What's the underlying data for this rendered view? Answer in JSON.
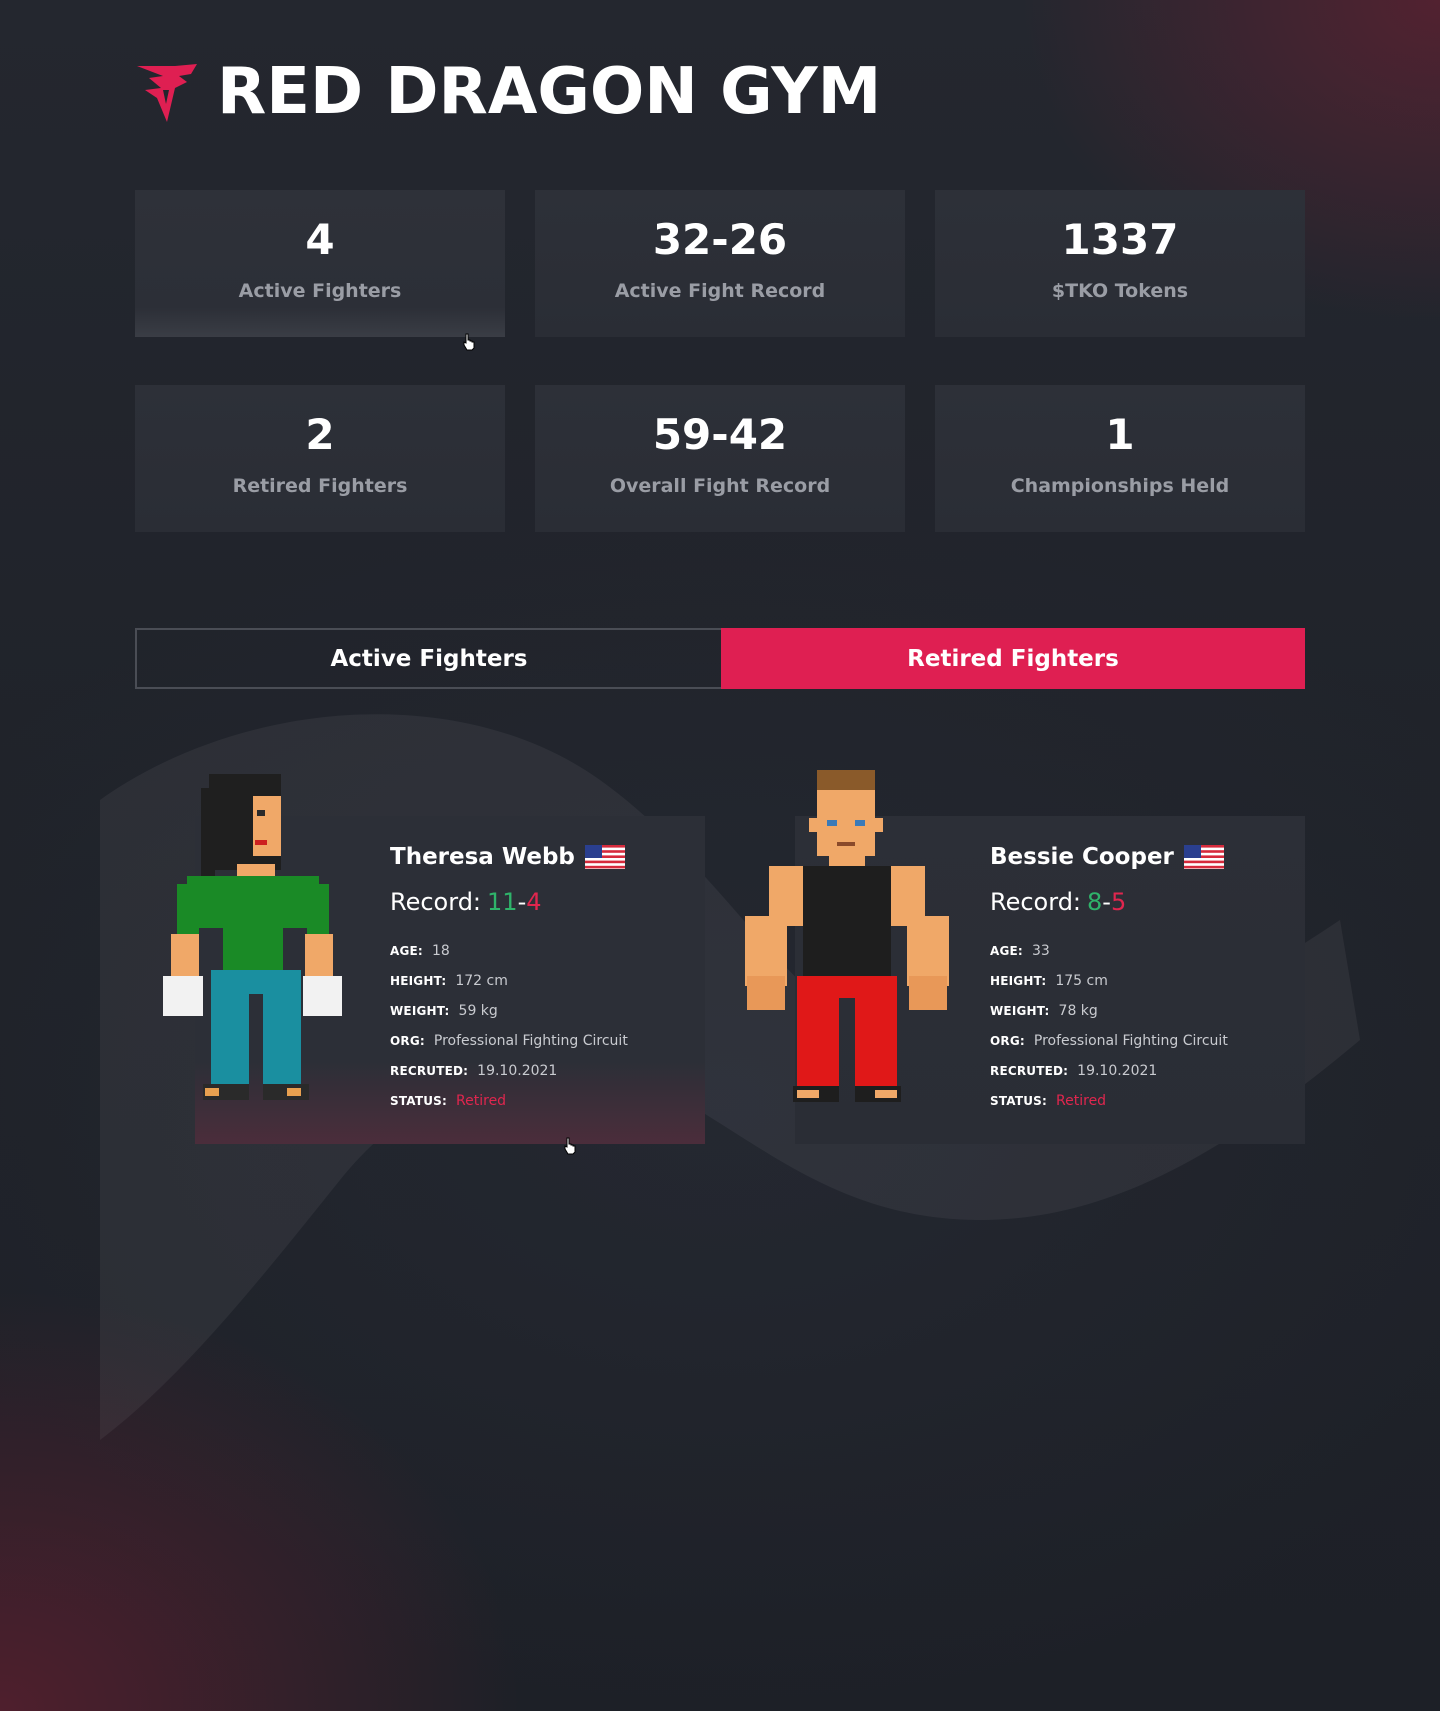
{
  "brand": {
    "title": "RED DRAGON GYM",
    "accent": "#df1f52"
  },
  "stats": [
    {
      "value": "4",
      "label": "Active Fighters"
    },
    {
      "value": "32-26",
      "label": "Active Fight Record"
    },
    {
      "value": "1337",
      "label": "$TKO Tokens"
    },
    {
      "value": "2",
      "label": "Retired Fighters"
    },
    {
      "value": "59-42",
      "label": "Overall Fight Record"
    },
    {
      "value": "1",
      "label": "Championships Held"
    }
  ],
  "tabs": {
    "active_label": "Active Fighters",
    "retired_label": "Retired Fighters",
    "selected": "Retired Fighters"
  },
  "fighters": [
    {
      "name": "Theresa Webb",
      "flag": "us-flag-icon",
      "record_label": "Record:",
      "wins": "11",
      "losses": "4",
      "age_key": "AGE:",
      "age": "18",
      "height_key": "HEIGHT:",
      "height": "172 cm",
      "weight_key": "WEIGHT:",
      "weight": "59 kg",
      "org_key": "ORG:",
      "org": "Professional Fighting Circuit",
      "recruited_key": "RECRUTED:",
      "recruited": "19.10.2021",
      "status_key": "STATUS:",
      "status": "Retired"
    },
    {
      "name": "Bessie Cooper",
      "flag": "us-flag-icon",
      "record_label": "Record:",
      "wins": "8",
      "losses": "5",
      "age_key": "AGE:",
      "age": "33",
      "height_key": "HEIGHT:",
      "height": "175 cm",
      "weight_key": "WEIGHT:",
      "weight": "78 kg",
      "org_key": "ORG:",
      "org": "Professional Fighting Circuit",
      "recruited_key": "RECRUTED:",
      "recruited": "19.10.2021",
      "status_key": "STATUS:",
      "status": "Retired"
    }
  ],
  "colors": {
    "win": "#2fb36a",
    "loss": "#e0264e",
    "card": "#2c2f37"
  }
}
